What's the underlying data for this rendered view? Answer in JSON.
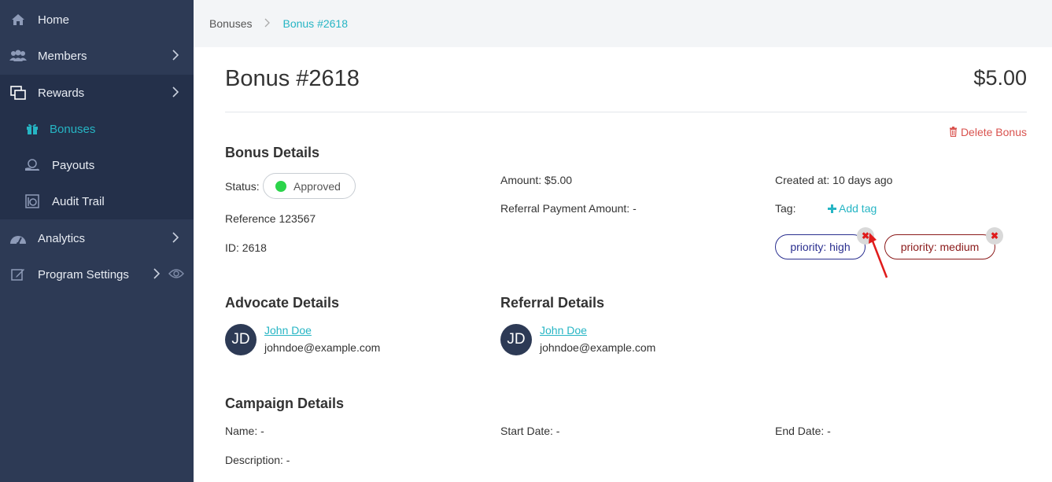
{
  "sidebar": {
    "items": [
      {
        "label": "Home",
        "icon": "home-icon"
      },
      {
        "label": "Members",
        "icon": "users-icon"
      },
      {
        "label": "Rewards",
        "icon": "rewards-icon"
      },
      {
        "label": "Analytics",
        "icon": "analytics-icon"
      },
      {
        "label": "Program Settings",
        "icon": "edit-icon"
      }
    ],
    "sub_items": [
      {
        "label": "Bonuses",
        "icon": "gift-icon"
      },
      {
        "label": "Payouts",
        "icon": "payouts-icon"
      },
      {
        "label": "Audit Trail",
        "icon": "audit-icon"
      }
    ]
  },
  "breadcrumb": {
    "parent": "Bonuses",
    "current": "Bonus #2618"
  },
  "header": {
    "title": "Bonus #2618",
    "amount": "$5.00",
    "delete_label": "Delete Bonus"
  },
  "bonus_details": {
    "heading": "Bonus Details",
    "status_label": "Status:",
    "status_value": "Approved",
    "status_color": "#2bd44a",
    "reference": "Reference 123567",
    "id": "ID: 2618",
    "amount": "Amount: $5.00",
    "referral_payment": "Referral Payment Amount: -",
    "created_at": "Created at: 10 days ago",
    "tag_label": "Tag:",
    "add_tag": "Add tag",
    "tags": [
      {
        "label": "priority: high",
        "color": "#2a2f8f"
      },
      {
        "label": "priority: medium",
        "color": "#8b1a1a"
      }
    ]
  },
  "advocate": {
    "heading": "Advocate Details",
    "initials": "JD",
    "name": "John Doe",
    "email": "johndoe@example.com"
  },
  "referral": {
    "heading": "Referral Details",
    "initials": "JD",
    "name": "John Doe",
    "email": "johndoe@example.com"
  },
  "campaign": {
    "heading": "Campaign Details",
    "name": "Name: -",
    "start_date": "Start Date: -",
    "end_date": "End Date: -",
    "description": "Description: -"
  },
  "colors": {
    "accent": "#26b5c4",
    "sidebar": "#2d3a55",
    "danger": "#d9534f"
  }
}
